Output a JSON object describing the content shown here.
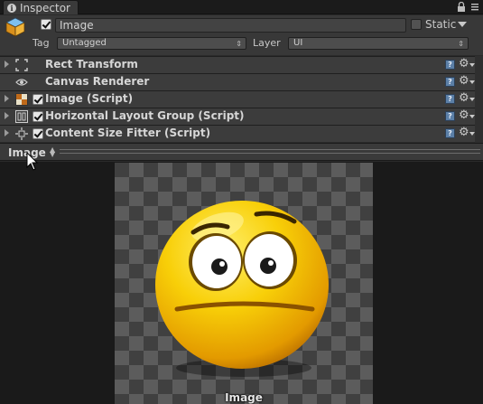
{
  "window": {
    "tab_title": "Inspector"
  },
  "header": {
    "active": true,
    "object_name": "Image",
    "static_label": "Static",
    "static_checked": false,
    "tag_label": "Tag",
    "tag_value": "Untagged",
    "layer_label": "Layer",
    "layer_value": "UI"
  },
  "components": [
    {
      "title": "Rect Transform",
      "icon": "rect-transform-icon",
      "has_checkbox": false
    },
    {
      "title": "Canvas Renderer",
      "icon": "eye-icon",
      "has_checkbox": false
    },
    {
      "title": "Image (Script)",
      "icon": "image-script-icon",
      "has_checkbox": true,
      "enabled": true
    },
    {
      "title": "Horizontal Layout Group (Script)",
      "icon": "layout-group-icon",
      "has_checkbox": true,
      "enabled": true
    },
    {
      "title": "Content Size Fitter (Script)",
      "icon": "size-fitter-icon",
      "has_checkbox": true,
      "enabled": true
    }
  ],
  "component_buttons": {
    "help": "?",
    "gear": "⚙"
  },
  "preview": {
    "title": "Image",
    "caption": "Image",
    "subject": "yellow-smiley-emoji"
  },
  "colors": {
    "accent_blue": "#5b7fa7",
    "smiley_yellow": "#f5c400",
    "panel_bg": "#383838"
  }
}
